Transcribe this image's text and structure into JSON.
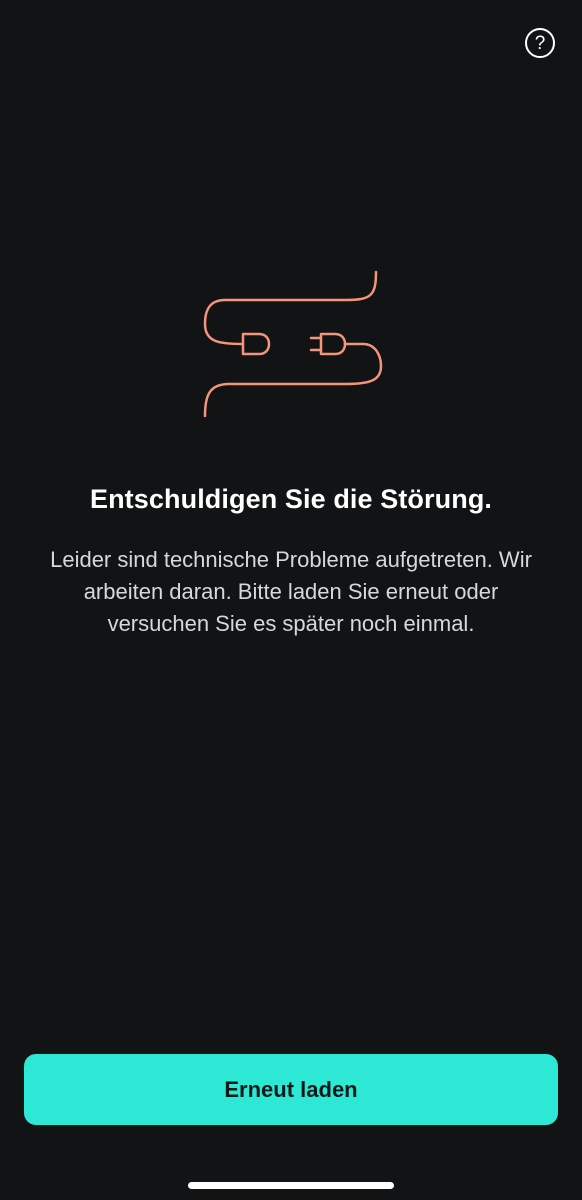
{
  "help": {
    "icon": "question-circle-icon",
    "glyph": "?"
  },
  "illustration": {
    "icon": "unplugged-cable-icon",
    "color": "#f2957a"
  },
  "error": {
    "title": "Entschuldigen Sie die Störung.",
    "message": "Leider sind technische Probleme aufgetreten. Wir arbeiten daran. Bitte laden Sie erneut oder versuchen Sie es später noch einmal."
  },
  "actions": {
    "reload_label": "Erneut laden"
  },
  "colors": {
    "background": "#111315",
    "accent": "#2de8d4",
    "illustration": "#f2957a"
  }
}
